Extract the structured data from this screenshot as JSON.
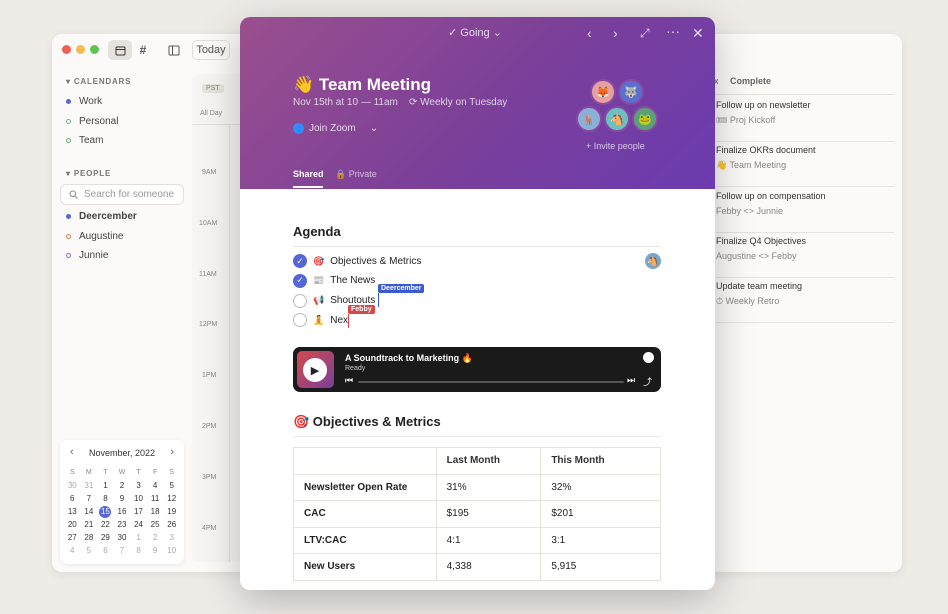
{
  "calendar_app": {
    "today_label": "Today",
    "timezone": "PST",
    "all_day": "All Day",
    "calendars_heading": "CALENDARS",
    "calendars": [
      {
        "label": "Work",
        "color": "#5566d9",
        "filled": true
      },
      {
        "label": "Personal",
        "color": "#6fb3a8",
        "filled": false
      },
      {
        "label": "Team",
        "color": "#6fb37a",
        "filled": false
      }
    ],
    "people_heading": "PEOPLE",
    "search_placeholder": "Search for someone",
    "people": [
      {
        "label": "Deercember",
        "color": "#5566d9",
        "filled": true
      },
      {
        "label": "Augustine",
        "color": "#e07a5f",
        "filled": false
      },
      {
        "label": "Junnie",
        "color": "#9a6fd0",
        "filled": false
      }
    ],
    "times": [
      "9AM",
      "10AM",
      "11AM",
      "12PM",
      "1PM",
      "2PM",
      "3PM",
      "4PM"
    ],
    "mini_calendar": {
      "month": "November, 2022",
      "dow": [
        "S",
        "M",
        "T",
        "W",
        "T",
        "F",
        "S"
      ],
      "days": [
        [
          "30",
          "out"
        ],
        [
          "31",
          "out"
        ],
        [
          "1",
          ""
        ],
        [
          "2",
          ""
        ],
        [
          "3",
          ""
        ],
        [
          "4",
          ""
        ],
        [
          "5",
          ""
        ],
        [
          "6",
          ""
        ],
        [
          "7",
          ""
        ],
        [
          "8",
          ""
        ],
        [
          "9",
          ""
        ],
        [
          "10",
          ""
        ],
        [
          "11",
          ""
        ],
        [
          "12",
          ""
        ],
        [
          "13",
          ""
        ],
        [
          "14",
          ""
        ],
        [
          "15",
          "today"
        ],
        [
          "16",
          ""
        ],
        [
          "17",
          ""
        ],
        [
          "18",
          ""
        ],
        [
          "19",
          ""
        ],
        [
          "20",
          ""
        ],
        [
          "21",
          ""
        ],
        [
          "22",
          ""
        ],
        [
          "23",
          ""
        ],
        [
          "24",
          ""
        ],
        [
          "25",
          ""
        ],
        [
          "26",
          ""
        ],
        [
          "27",
          ""
        ],
        [
          "28",
          ""
        ],
        [
          "29",
          ""
        ],
        [
          "30",
          ""
        ],
        [
          "1",
          "out"
        ],
        [
          "2",
          "out"
        ],
        [
          "3",
          "out"
        ],
        [
          "4",
          "out"
        ],
        [
          "5",
          "out"
        ],
        [
          "6",
          "out"
        ],
        [
          "7",
          "out"
        ],
        [
          "8",
          "out"
        ],
        [
          "9",
          "out"
        ],
        [
          "10",
          "out"
        ]
      ]
    }
  },
  "tasks_panel": {
    "tab_inbox": "x",
    "tab_complete": "Complete",
    "items": [
      {
        "title": "Follow up on newsletter",
        "sub": "🎟 Proj Kickoff"
      },
      {
        "title": "Finalize OKRs document",
        "sub": "👋 Team Meeting"
      },
      {
        "title": "Follow up on compensation",
        "sub": "Febby <> Junnie"
      },
      {
        "title": "Finalize Q4 Objectives",
        "sub": "Augustine <> Febby"
      },
      {
        "title": "Update team meeting",
        "sub": "⏱ Weekly Retro"
      }
    ]
  },
  "event": {
    "status": "Going",
    "emoji": "👋",
    "title": "Team Meeting",
    "datetime": "Nov 15th at 10 — 11am",
    "recurrence": "Weekly on Tuesday",
    "join_label": "Join Zoom",
    "invite_label": "+ Invite people",
    "tab_shared": "Shared",
    "tab_private": "Private",
    "avatars": [
      "🦊",
      "🐺",
      "🦌",
      "🐴",
      "🐸"
    ],
    "agenda_heading": "Agenda",
    "agenda": [
      {
        "checked": true,
        "emoji": "🎯",
        "text": "Objectives & Metrics"
      },
      {
        "checked": true,
        "emoji": "📰",
        "text": "The News"
      },
      {
        "checked": false,
        "emoji": "📢",
        "text": "Shoutouts"
      },
      {
        "checked": false,
        "emoji": "🧘",
        "text": "Nex"
      }
    ],
    "cursors": [
      {
        "name": "Deercember",
        "color": "#3a5bd0"
      },
      {
        "name": "Febby",
        "color": "#d24a4a"
      }
    ],
    "player": {
      "title": "A Soundtrack to Marketing 🔥",
      "status": "Ready"
    },
    "metrics_heading": "🎯 Objectives & Metrics",
    "table": {
      "headers": [
        "",
        "Last Month",
        "This Month"
      ],
      "rows": [
        [
          "Newsletter Open Rate",
          "31%",
          "32%"
        ],
        [
          "CAC",
          "$195",
          "$201"
        ],
        [
          "LTV:CAC",
          "4:1",
          "3:1"
        ],
        [
          "New Users",
          "4,338",
          "5,915"
        ]
      ]
    }
  }
}
